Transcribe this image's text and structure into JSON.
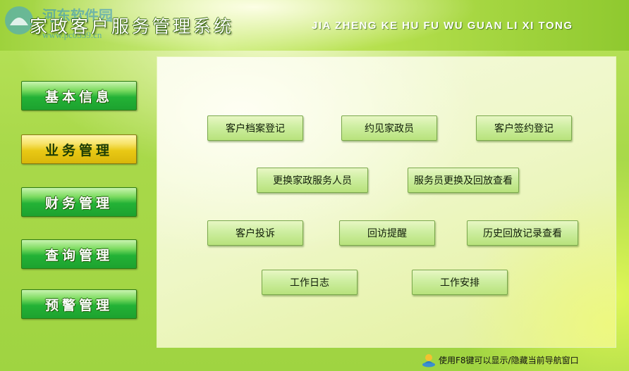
{
  "header": {
    "title": "家政客户服务管理系统",
    "pinyin": "JIA ZHENG KE HU FU WU GUAN LI XI TONG",
    "watermark_text": "河东软件园",
    "watermark_url": "www.pc0359.cn"
  },
  "sidebar": {
    "items": [
      {
        "label": "基本信息",
        "active": false
      },
      {
        "label": "业务管理",
        "active": true
      },
      {
        "label": "财务管理",
        "active": false
      },
      {
        "label": "查询管理",
        "active": false
      },
      {
        "label": "预警管理",
        "active": false
      }
    ]
  },
  "actions": {
    "customer_register": "客户档案登记",
    "meet_housekeeper": "约见家政员",
    "contract_register": "客户签约登记",
    "change_staff": "更换家政服务人员",
    "staff_change_review": "服务员更换及回放查看",
    "complaint": "客户投诉",
    "revisit_reminder": "回访提醒",
    "history_review": "历史回放记录查看",
    "work_log": "工作日志",
    "work_schedule": "工作安排"
  },
  "footer": {
    "hint": "使用F8键可以显示/隐藏当前导航窗口"
  },
  "colors": {
    "nav_green": "#23b236",
    "nav_active_yellow": "#e9c915",
    "panel_bg": "#eef7c6",
    "app_bg": "#a9d94a"
  }
}
